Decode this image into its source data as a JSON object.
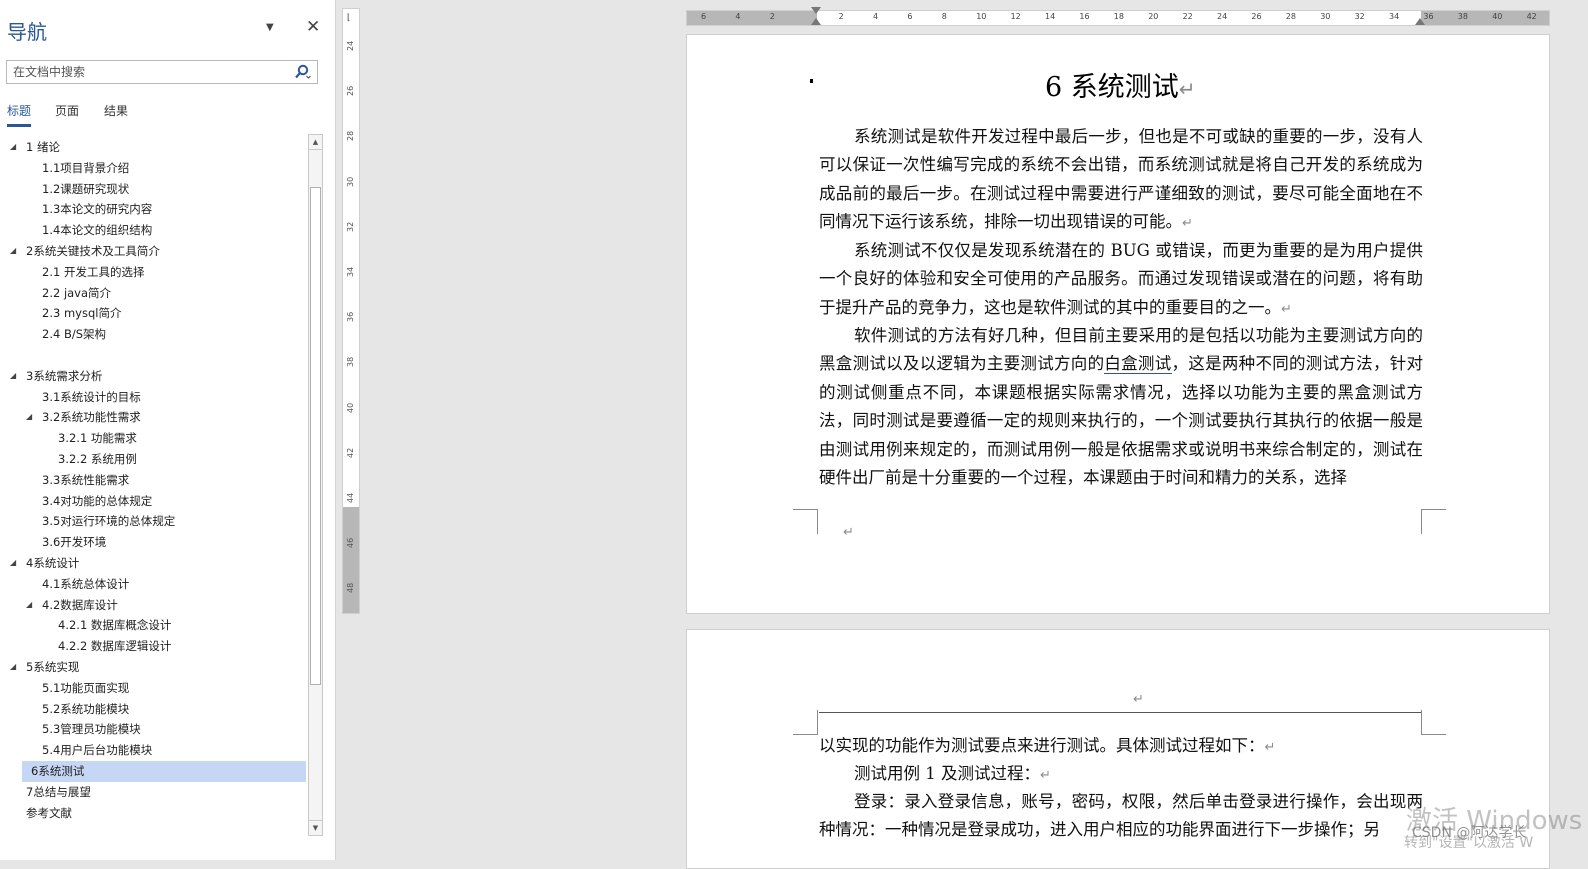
{
  "nav": {
    "title": "导航",
    "search_placeholder": "在文档中搜索",
    "tabs": [
      {
        "label": "标题",
        "active": true
      },
      {
        "label": "页面",
        "active": false
      },
      {
        "label": "结果",
        "active": false
      }
    ],
    "tree": [
      {
        "label": "1 绪论",
        "level": 1,
        "expanded": true
      },
      {
        "label": "1.1项目背景介绍",
        "level": 2
      },
      {
        "label": "1.2课题研究现状",
        "level": 2
      },
      {
        "label": "1.3本论文的研究内容",
        "level": 2
      },
      {
        "label": "1.4本论文的组织结构",
        "level": 2
      },
      {
        "label": "2系统关键技术及工具简介",
        "level": 1,
        "expanded": true
      },
      {
        "label": "2.1 开发工具的选择",
        "level": 2
      },
      {
        "label": "2.2 java简介",
        "level": 2
      },
      {
        "label": "2.3 mysql简介",
        "level": 2
      },
      {
        "label": "2.4 B/S架构",
        "level": 2
      },
      {
        "label": "",
        "level": 1
      },
      {
        "label": "3系统需求分析",
        "level": 1,
        "expanded": true
      },
      {
        "label": "3.1系统设计的目标",
        "level": 2
      },
      {
        "label": "3.2系统功能性需求",
        "level": 2,
        "expanded": true
      },
      {
        "label": "3.2.1 功能需求",
        "level": 3
      },
      {
        "label": "3.2.2 系统用例",
        "level": 3
      },
      {
        "label": "3.3系统性能需求",
        "level": 2
      },
      {
        "label": "3.4对功能的总体规定",
        "level": 2
      },
      {
        "label": "3.5对运行环境的总体规定",
        "level": 2
      },
      {
        "label": "3.6开发环境",
        "level": 2
      },
      {
        "label": "4系统设计",
        "level": 1,
        "expanded": true
      },
      {
        "label": "4.1系统总体设计",
        "level": 2
      },
      {
        "label": "4.2数据库设计",
        "level": 2,
        "expanded": true
      },
      {
        "label": "4.2.1 数据库概念设计",
        "level": 3
      },
      {
        "label": "4.2.2 数据库逻辑设计",
        "level": 3
      },
      {
        "label": "5系统实现",
        "level": 1,
        "expanded": true
      },
      {
        "label": "5.1功能页面实现",
        "level": 2
      },
      {
        "label": "5.2系统功能模块",
        "level": 2
      },
      {
        "label": "5.3管理员功能模块",
        "level": 2
      },
      {
        "label": "5.4用户后台功能模块",
        "level": 2
      },
      {
        "label": "6系统测试",
        "level": 1,
        "selected": true
      },
      {
        "label": "7总结与展望",
        "level": 1
      },
      {
        "label": "参考文献",
        "level": 1
      }
    ]
  },
  "ruler": {
    "horizontal_labels": [
      "6",
      "4",
      "2",
      "",
      "2",
      "4",
      "6",
      "8",
      "10",
      "12",
      "14",
      "16",
      "18",
      "20",
      "22",
      "24",
      "26",
      "28",
      "30",
      "32",
      "34",
      "36",
      "38",
      "40",
      "42"
    ],
    "vertical_labels": [
      "24",
      "26",
      "28",
      "30",
      "32",
      "34",
      "36",
      "38",
      "40",
      "42",
      "44",
      "46",
      "48"
    ]
  },
  "document": {
    "heading": "6 系统测试",
    "paragraph_mark": "↵",
    "paragraphs": [
      "系统测试是软件开发过程中最后一步，但也是不可或缺的重要的一步，没有人可以保证一次性编写完成的系统不会出错，而系统测试就是将自己开发的系统成为成品前的最后一步。在测试过程中需要进行严谨细致的测试，要尽可能全面地在不同情况下运行该系统，排除一切出现错误的可能。",
      "系统测试不仅仅是发现系统潜在的 BUG 或错误，而更为重要的是为用户提供一个良好的体验和安全可使用的产品服务。而通过发现错误或潜在的问题，将有助于提升产品的竞争力，这也是软件测试的其中的重要目的之一。"
    ],
    "p3_before": "软件测试的方法有好几种，但目前主要采用的是包括以功能为主要测试方向的黑盒测试以及以逻辑为主要测试方向的",
    "p3_link": "白盒测试",
    "p3_after": "，这是两种不同的测试方法，针对的测试侧重点不同，本课题根据实际需求情况，选择以功能为主要的黑盒测试方法，同时测试是要遵循一定的规则来执行的，一个测试要执行其执行的依据一般是由测试用例来规定的，而测试用例一般是依据需求或说明书来综合制定的，测试在硬件出厂前是十分重要的一个过程，本课题由于时间和精力的关系，选择",
    "page2": {
      "line1": "以实现的功能作为测试要点来进行测试。具体测试过程如下：",
      "line2": "测试用例 1 及测试过程：",
      "line3": "登录：录入登录信息，账号，密码，权限，然后单击登录进行操作，会出现两种情况：一种情况是登录成功，进入用户相应的功能界面进行下一步操作；另"
    }
  },
  "overlay": {
    "watermark": "激活 Windows",
    "watermark_sub": "转到\"设置\"以激活 W",
    "csdn": "CSDN @阿达学长"
  }
}
